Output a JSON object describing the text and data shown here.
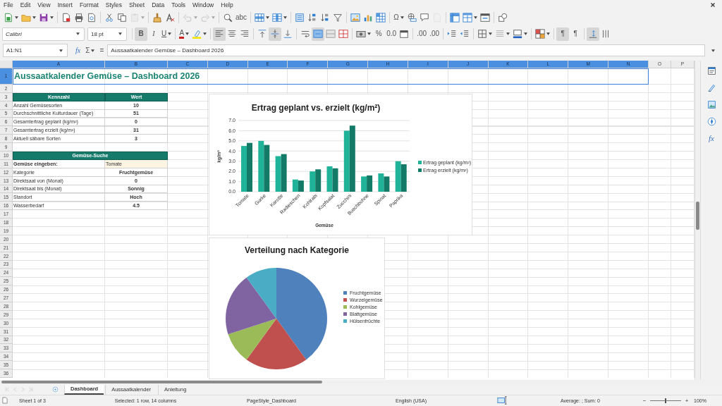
{
  "menu_bar": [
    "File",
    "Edit",
    "View",
    "Insert",
    "Format",
    "Styles",
    "Sheet",
    "Data",
    "Tools",
    "Window",
    "Help"
  ],
  "toolbar_standard": {
    "buttons": [
      {
        "disabled": false
      },
      {
        "disabled": false
      },
      {
        "disabled": false
      },
      {
        "disabled": false
      },
      {
        "disabled": false
      },
      {
        "disabled": false
      },
      {
        "disabled": false
      },
      {
        "disabled": false
      },
      {
        "disabled": true
      },
      {
        "disabled": false
      },
      {
        "disabled": false
      },
      {
        "disabled": true
      },
      {
        "disabled": true
      },
      {
        "disabled": false
      },
      {
        "disabled": false,
        "label": "abc"
      },
      {
        "disabled": false
      },
      {
        "disabled": false
      },
      {
        "disabled": false
      },
      {
        "disabled": false
      },
      {
        "disabled": false
      },
      {
        "disabled": false
      },
      {
        "disabled": false
      },
      {
        "disabled": false
      },
      {
        "disabled": false
      },
      {
        "disabled": false,
        "label": "Ω"
      },
      {
        "disabled": false
      },
      {
        "disabled": false
      },
      {
        "disabled": true
      },
      {
        "disabled": false
      },
      {
        "disabled": false
      },
      {
        "disabled": false
      },
      {
        "disabled": false
      }
    ]
  },
  "toolbar_format": {
    "font_name": "Calibri",
    "font_size": "18 pt",
    "buttons": [
      {
        "label": "B",
        "selected": true
      },
      {
        "label": "I",
        "selected": false
      },
      {
        "label": "U",
        "selected": false
      },
      {
        "label": "A",
        "selected": false
      },
      {
        "selected": false
      },
      {
        "selected": true
      },
      {
        "selected": false
      },
      {
        "selected": false
      },
      {
        "selected": false
      },
      {
        "selected": true
      },
      {
        "selected": false
      },
      {
        "selected": false
      },
      {
        "selected": true
      },
      {
        "selected": false
      },
      {
        "selected": false
      },
      {
        "selected": false
      },
      {
        "label": "%",
        "selected": false
      },
      {
        "label": "0.0",
        "selected": false
      },
      {
        "selected": false
      },
      {
        "label": ".00",
        "selected": false
      },
      {
        "label": ".00",
        "selected": false
      },
      {
        "selected": false
      },
      {
        "selected": false
      },
      {
        "selected": false
      },
      {
        "selected": false
      },
      {
        "selected": false
      },
      {
        "selected": false
      },
      {
        "label": "¶",
        "selected": true
      },
      {
        "label": "¶",
        "selected": false
      },
      {
        "selected": true
      },
      {
        "selected": false
      }
    ]
  },
  "formula_bar": {
    "name_box": "A1:N1",
    "function_wizard": "fx",
    "sum": "Σ",
    "equals": "=",
    "content": "Aussaatkalender Gemüse – Dashboard 2026"
  },
  "sheet": {
    "columns": [
      {
        "label": "A",
        "selected": true
      },
      {
        "label": "B",
        "selected": true
      },
      {
        "label": "C",
        "selected": true
      },
      {
        "label": "D",
        "selected": true
      },
      {
        "label": "E",
        "selected": true
      },
      {
        "label": "F",
        "selected": true
      },
      {
        "label": "G",
        "selected": true
      },
      {
        "label": "H",
        "selected": true
      },
      {
        "label": "I",
        "selected": true
      },
      {
        "label": "J",
        "selected": true
      },
      {
        "label": "K",
        "selected": true
      },
      {
        "label": "L",
        "selected": true
      },
      {
        "label": "M",
        "selected": true
      },
      {
        "label": "N",
        "selected": true
      },
      {
        "label": "O",
        "selected": false
      },
      {
        "label": "P",
        "selected": false
      }
    ],
    "rows": [
      {
        "label": "1",
        "selected": true
      },
      {
        "label": "2",
        "selected": false
      },
      {
        "label": "3",
        "selected": false
      },
      {
        "label": "4",
        "selected": false
      },
      {
        "label": "5",
        "selected": false
      },
      {
        "label": "6",
        "selected": false
      },
      {
        "label": "7",
        "selected": false
      },
      {
        "label": "8",
        "selected": false
      },
      {
        "label": "9",
        "selected": false
      },
      {
        "label": "10",
        "selected": false
      },
      {
        "label": "11",
        "selected": false
      },
      {
        "label": "12",
        "selected": false
      },
      {
        "label": "13",
        "selected": false
      },
      {
        "label": "14",
        "selected": false
      },
      {
        "label": "15",
        "selected": false
      },
      {
        "label": "16",
        "selected": false
      },
      {
        "label": "17",
        "selected": false
      },
      {
        "label": "18",
        "selected": false
      },
      {
        "label": "19",
        "selected": false
      },
      {
        "label": "20",
        "selected": false
      },
      {
        "label": "21",
        "selected": false
      },
      {
        "label": "22",
        "selected": false
      },
      {
        "label": "23",
        "selected": false
      },
      {
        "label": "24",
        "selected": false
      },
      {
        "label": "25",
        "selected": false
      },
      {
        "label": "26",
        "selected": false
      },
      {
        "label": "27",
        "selected": false
      },
      {
        "label": "28",
        "selected": false
      },
      {
        "label": "29",
        "selected": false
      },
      {
        "label": "30",
        "selected": false
      },
      {
        "label": "31",
        "selected": false
      },
      {
        "label": "32",
        "selected": false
      },
      {
        "label": "33",
        "selected": false
      },
      {
        "label": "34",
        "selected": false
      },
      {
        "label": "35",
        "selected": false
      },
      {
        "label": "36",
        "selected": false
      }
    ],
    "title": "Aussaatkalender Gemüse – Dashboard 2026",
    "kpi_table": {
      "columns": [
        "Kennzahl",
        "Wert"
      ],
      "rows": [
        {
          "label": "Anzahl Gemüsesorten",
          "value": "10"
        },
        {
          "label": "Durchschnittliche Kulturdauer (Tage)",
          "value": "51"
        },
        {
          "label": "Gesamtertrag geplant (kg/m²)",
          "value": "0"
        },
        {
          "label": "Gesamtertrag erzielt (kg/m²)",
          "value": "31"
        },
        {
          "label": "Aktuell säbare Sorten",
          "value": "3"
        }
      ]
    },
    "search_table": {
      "title": "Gemüse-Suche",
      "rows": [
        {
          "kind": "input",
          "label": "Gemüse eingeben:",
          "value": "Tomate"
        },
        {
          "kind": "result",
          "label": "Kategorie",
          "value": "Fruchtgemüse"
        },
        {
          "kind": "result",
          "label": "Direktsaat von (Monat)",
          "value": "0"
        },
        {
          "kind": "result",
          "label": "Direktsaat bis (Monat)",
          "value": "Sonnig"
        },
        {
          "kind": "result",
          "label": "Standort",
          "value": "Hoch"
        },
        {
          "kind": "result",
          "label": "Wasserbedarf",
          "value": "4.5"
        }
      ]
    },
    "bar_chart": {
      "chart_data": {
        "type": "bar",
        "title": "Ertrag geplant vs. erzielt (kg/m²)",
        "xlabel": "Gemüse",
        "ylabel": "kg/m²",
        "categories": [
          "Tomate",
          "Gurke",
          "Karotte",
          "Radieschen",
          "Kohlrabi",
          "Kopfsalat",
          "Zucchini",
          "Buschbohne",
          "Spinat",
          "Paprika"
        ],
        "series": [
          {
            "name": "Ertrag geplant (kg/m²)",
            "color": "#1fb39a",
            "values": [
              4.5,
              5.0,
              3.5,
              1.2,
              2.0,
              2.5,
              6.0,
              1.5,
              1.8,
              3.0
            ]
          },
          {
            "name": "Ertrag erzielt (kg/m²)",
            "color": "#137a68",
            "values": [
              4.8,
              4.6,
              3.7,
              1.1,
              2.2,
              2.3,
              6.5,
              1.6,
              1.5,
              2.7
            ]
          }
        ],
        "ylim": [
          0,
          7
        ],
        "grid": true,
        "legend": true,
        "yticks": [
          {
            "value": 0,
            "label": "0.0"
          },
          {
            "value": 1,
            "label": "1.0"
          },
          {
            "value": 2,
            "label": "2.0"
          },
          {
            "value": 3,
            "label": "3.0"
          },
          {
            "value": 4,
            "label": "4.0"
          },
          {
            "value": 5,
            "label": "5.0"
          },
          {
            "value": 6,
            "label": "6.0"
          },
          {
            "value": 7,
            "label": "7.0"
          }
        ]
      }
    },
    "pie_chart": {
      "chart_data": {
        "type": "pie",
        "title": "Verteilung nach Kategorie",
        "categories": [
          "Fruchtgemüse",
          "Wurzelgemüse",
          "Kohlgemüse",
          "Blattgemüse",
          "Hülsenfrüchte"
        ],
        "values": [
          40,
          20,
          10,
          20,
          10
        ],
        "legend": true,
        "colors": [
          "#4f81bd",
          "#c0504d",
          "#9bbb59",
          "#8064a2",
          "#4bacc6"
        ]
      }
    }
  },
  "sidebar": {
    "functions": "fx"
  },
  "sheet_tabs": [
    {
      "label": "Dashboard",
      "selected": true
    },
    {
      "label": "Aussaatkalender",
      "selected": false
    },
    {
      "label": "Anleitung",
      "selected": false
    }
  ],
  "status_bar": {
    "sheet": "Sheet 1 of 3",
    "selection": "Selected: 1 row, 14 columns",
    "page_style": "PageStyle_Dashboard",
    "language": "English (USA)",
    "statistics": "Average: ; Sum: 0",
    "zoom_out": "−",
    "zoom_in": "+",
    "zoom": {
      "level": 0.5
    },
    "zoom_percent": "100%"
  }
}
